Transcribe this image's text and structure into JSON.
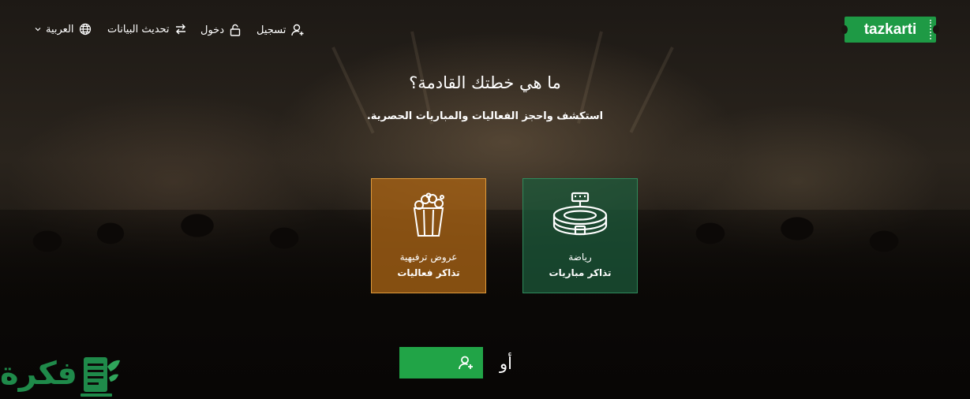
{
  "brand": {
    "logo_text": "tazkarti",
    "color": "#1e9a45"
  },
  "nav": {
    "register": "تسجيل",
    "login": "دخول",
    "update_data": "تحديث البيانات",
    "language": "العربية"
  },
  "hero": {
    "title": "ما هي خطتك القادمة؟",
    "subtitle": "استكشف واحجز الفعاليات والمباريات الحصرية."
  },
  "cards": {
    "sports": {
      "line1": "رياضة",
      "line2": "تذاكر مباريات",
      "icon": "stadium-icon",
      "color": "#1c5c3c"
    },
    "events": {
      "line1": "عروض ترفيهية",
      "line2": "تذاكر فعاليات",
      "icon": "popcorn-icon",
      "color": "#a86314"
    }
  },
  "cta": {
    "or_label": "أو",
    "register_icon": "add-user-icon",
    "color": "#21a447"
  },
  "watermark": {
    "text": "فكرة"
  }
}
